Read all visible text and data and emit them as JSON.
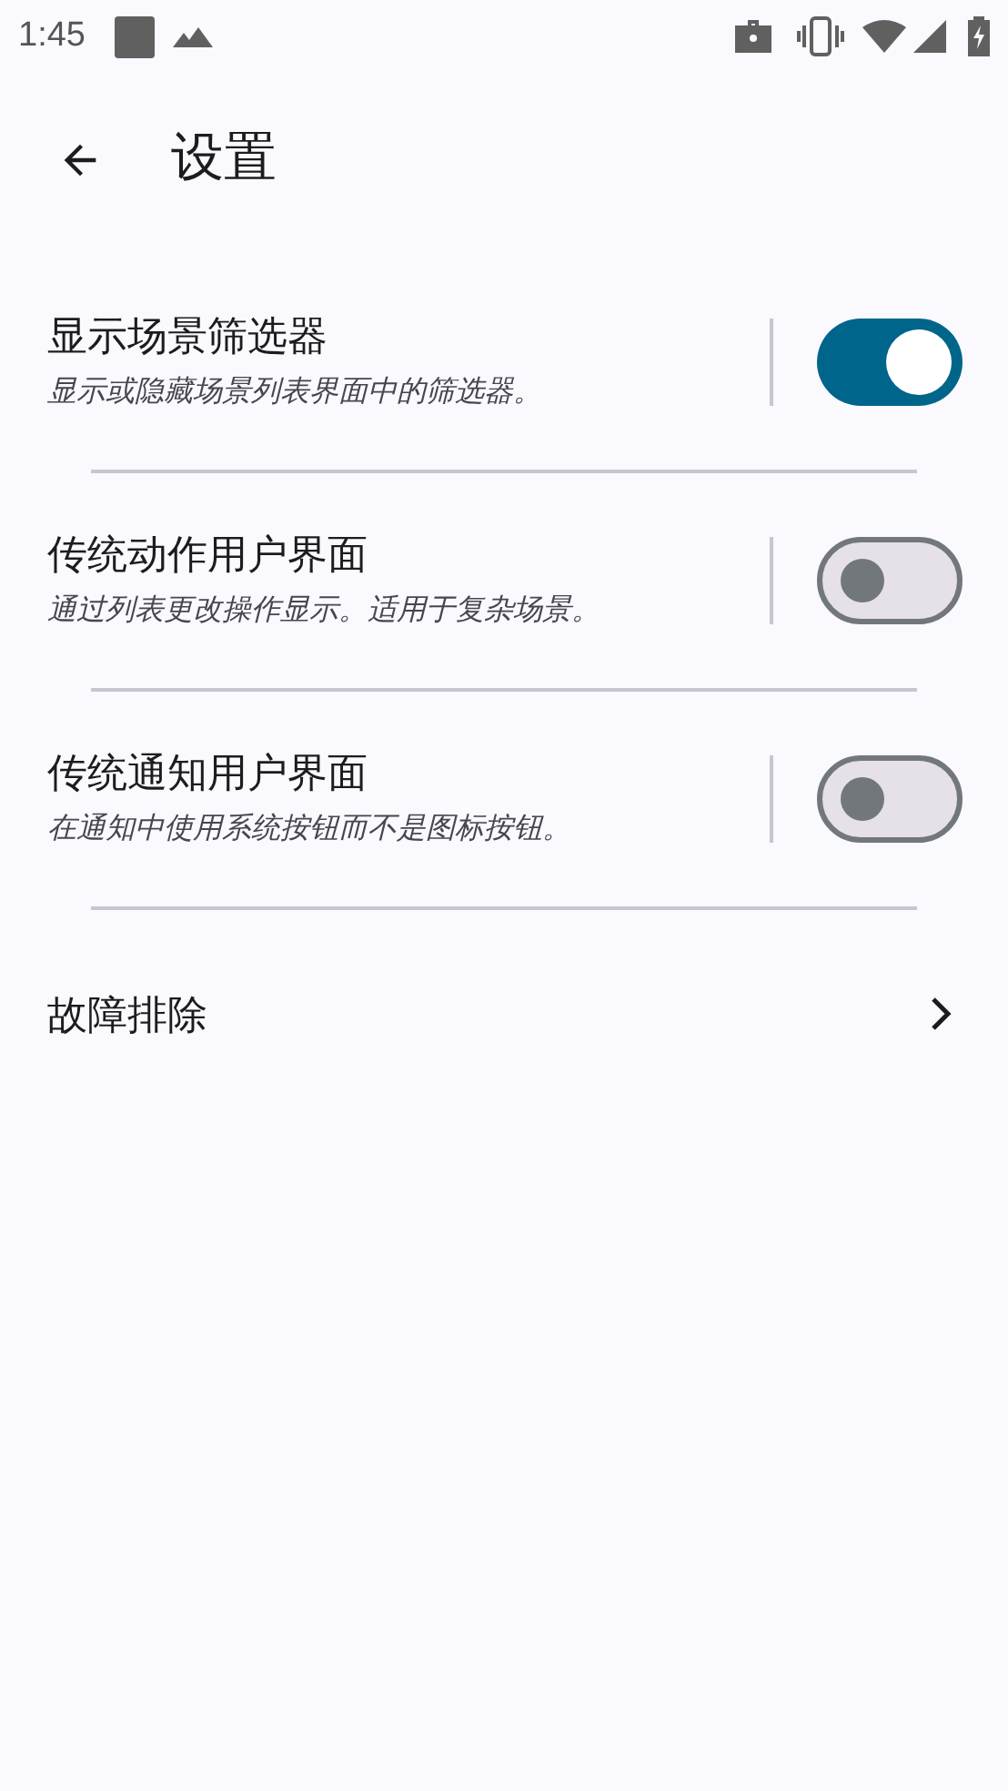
{
  "status_bar": {
    "time": "1:45"
  },
  "toolbar": {
    "title": "设置"
  },
  "settings": [
    {
      "kind": "switch",
      "title": "显示场景筛选器",
      "description": "显示或隐藏场景列表界面中的筛选器。",
      "on": true
    },
    {
      "kind": "switch",
      "title": "传统动作用户界面",
      "description": "通过列表更改操作显示。适用于复杂场景。",
      "on": false
    },
    {
      "kind": "switch",
      "title": "传统通知用户界面",
      "description": "在通知中使用系统按钮而不是图标按钮。",
      "on": false
    },
    {
      "kind": "link",
      "title": "故障排除"
    }
  ]
}
